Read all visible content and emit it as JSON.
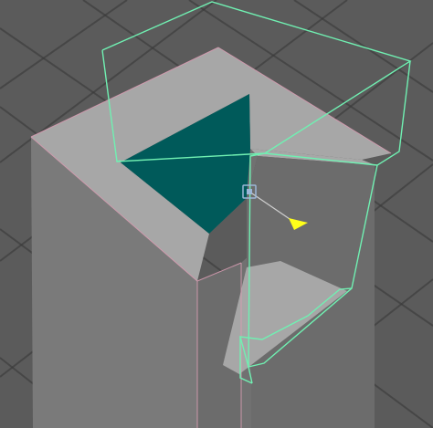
{
  "viewport": {
    "background": "#5b5b5b",
    "grid_color": "#3b3b3b"
  },
  "model": {
    "top_face_color": "#a7a7a7",
    "left_face_color": "#7a7a7a",
    "front_face_color": "#6c6c6c",
    "inner_wall_color": "#717171",
    "opening_face_color": "#005a5a",
    "edge_highlight_color": "#d59bb0"
  },
  "bounding_box": {
    "color": "#70f0b2"
  },
  "manipulator": {
    "handle_color": "#9bb7d8",
    "arrow_color": "#ffff1a",
    "axis_color": "#cfcfcf"
  }
}
